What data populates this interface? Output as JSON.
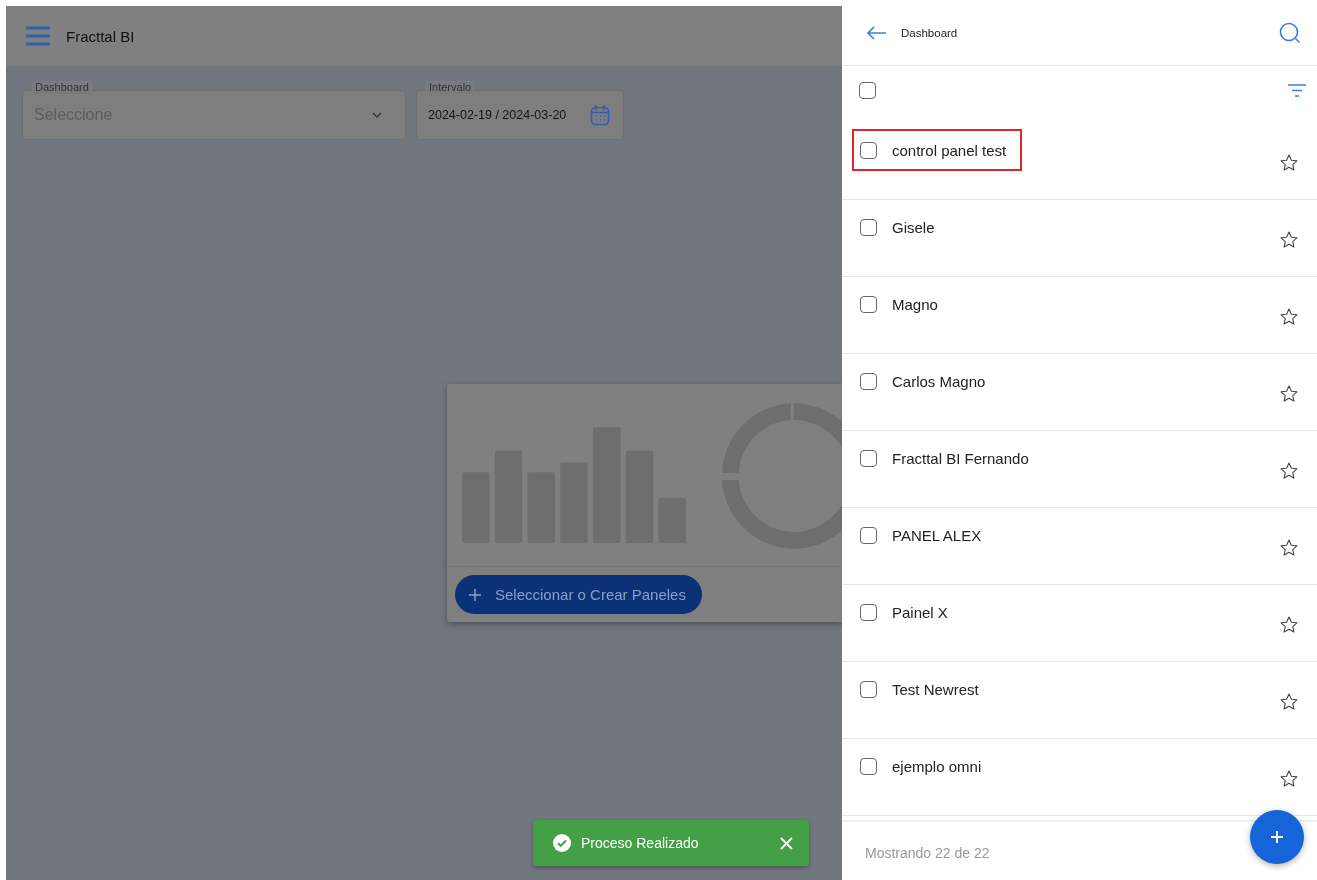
{
  "app_bar": {
    "title": "Fracttal BI"
  },
  "filters": [
    {
      "kind": "select",
      "label": "Dashboard",
      "placeholder": "Seleccione"
    },
    {
      "kind": "date",
      "label": "Intervalo",
      "value": "2024-02-19 / 2024-03-20"
    }
  ],
  "empty_card": {
    "button": "Seleccionar o Crear Paneles"
  },
  "toast": {
    "message": "Proceso Realizado"
  },
  "drawer": {
    "title": "Dashboard",
    "select_all_checked": false,
    "items": [
      {
        "name": "control panel test",
        "checked": false,
        "favorite": false,
        "highlighted": true
      },
      {
        "name": "Gisele",
        "checked": false,
        "favorite": false,
        "highlighted": false
      },
      {
        "name": "Magno",
        "checked": false,
        "favorite": false,
        "highlighted": false
      },
      {
        "name": "Carlos Magno",
        "checked": false,
        "favorite": false,
        "highlighted": false
      },
      {
        "name": "Fracttal BI Fernando",
        "checked": false,
        "favorite": false,
        "highlighted": false
      },
      {
        "name": "PANEL ALEX",
        "checked": false,
        "favorite": false,
        "highlighted": false
      },
      {
        "name": "Painel X",
        "checked": false,
        "favorite": false,
        "highlighted": false
      },
      {
        "name": "Test Newrest",
        "checked": false,
        "favorite": false,
        "highlighted": false
      },
      {
        "name": "ejemplo omni",
        "checked": false,
        "favorite": false,
        "highlighted": false
      }
    ],
    "footer": "Mostrando 22 de 22"
  }
}
